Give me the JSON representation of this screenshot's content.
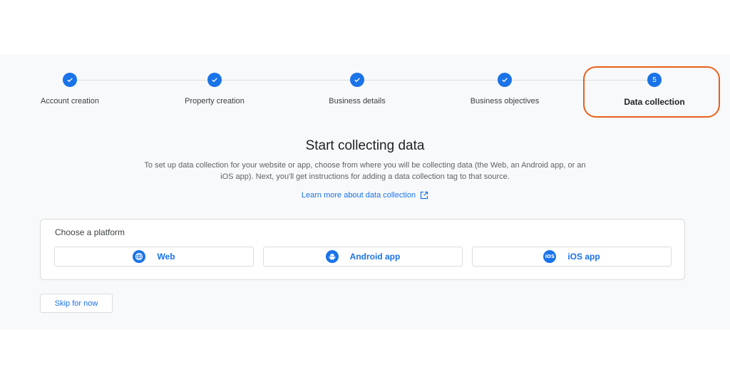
{
  "stepper": {
    "steps": [
      {
        "label": "Account creation",
        "status": "complete",
        "icon": "check-icon"
      },
      {
        "label": "Property creation",
        "status": "complete",
        "icon": "check-icon"
      },
      {
        "label": "Business details",
        "status": "complete",
        "icon": "check-icon"
      },
      {
        "label": "Business objectives",
        "status": "complete",
        "icon": "check-icon"
      },
      {
        "label": "Data collection",
        "status": "current",
        "number": "5"
      }
    ],
    "accent_color": "#1a73e8",
    "highlight_color": "#e8601a"
  },
  "main": {
    "title": "Start collecting data",
    "description": "To set up data collection for your website or app, choose from where you will be collecting data (the Web, an Android app, or an iOS app). Next, you'll get instructions for adding a data collection tag to that source.",
    "learn_more_label": "Learn more about data collection",
    "learn_more_icon": "open-in-new-icon"
  },
  "platform_card": {
    "title": "Choose a platform",
    "platforms": [
      {
        "label": "Web",
        "icon": "globe-icon"
      },
      {
        "label": "Android app",
        "icon": "android-icon"
      },
      {
        "label": "iOS app",
        "icon": "ios-icon",
        "icon_text": "iOS"
      }
    ]
  },
  "footer": {
    "skip_label": "Skip for now"
  }
}
